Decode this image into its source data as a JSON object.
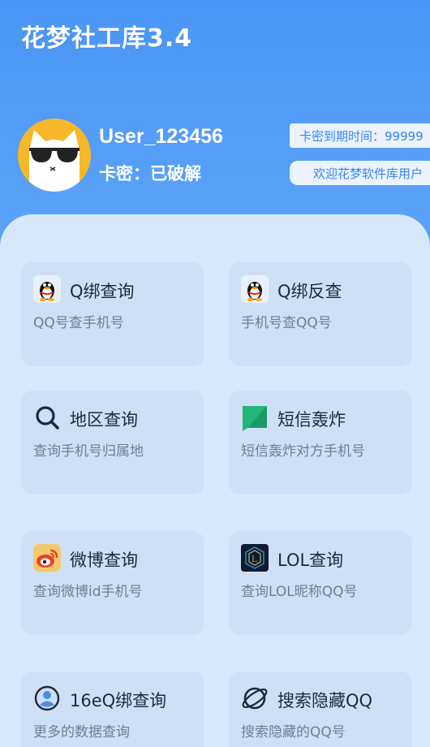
{
  "app": {
    "title": "花梦社工库3.4"
  },
  "user": {
    "name": "User_123456",
    "card_status": "卡密：已破解",
    "expiry": "卡密到期时间：99999",
    "welcome": "欢迎花梦软件库用户"
  },
  "tiles": [
    {
      "title": "Q绑查询",
      "subtitle": "QQ号查手机号",
      "icon": "qq-penguin-icon"
    },
    {
      "title": "Q绑反查",
      "subtitle": "手机号查QQ号",
      "icon": "qq-penguin-icon"
    },
    {
      "title": "地区查询",
      "subtitle": "查询手机号归属地",
      "icon": "search-icon"
    },
    {
      "title": "短信轰炸",
      "subtitle": "短信轰炸对方手机号",
      "icon": "message-icon"
    },
    {
      "title": "微博查询",
      "subtitle": "查询微博id手机号",
      "icon": "weibo-icon"
    },
    {
      "title": "LOL查询",
      "subtitle": "查询LOL昵称QQ号",
      "icon": "lol-icon"
    },
    {
      "title": "16eQ绑查询",
      "subtitle": "更多的数据查询",
      "icon": "person-circle-icon"
    },
    {
      "title": "搜索隐藏QQ",
      "subtitle": "搜索隐藏的QQ号",
      "icon": "planet-icon"
    }
  ],
  "colors": {
    "background": "#4f9af7",
    "panel": "#d8e8fb",
    "tile": "#cfe0f6",
    "pill_text": "#3a86ee",
    "avatar": "#f6b82b"
  }
}
